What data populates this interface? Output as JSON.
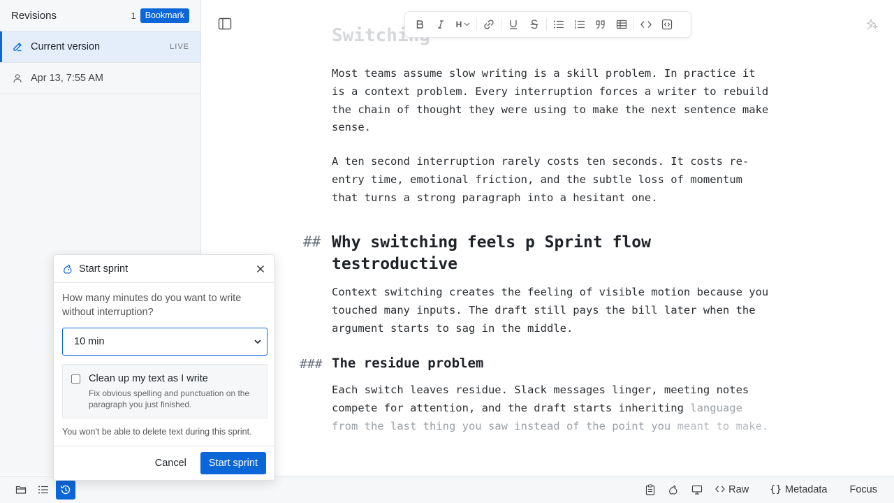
{
  "sidebar": {
    "title": "Revisions",
    "count": "1",
    "bookmark_label": "Bookmark",
    "items": [
      {
        "label": "Current version",
        "tag": "LIVE"
      },
      {
        "label": "Apr 13, 7:55 AM"
      }
    ]
  },
  "toolbar": {
    "heading_label": "H",
    "buttons": [
      "bold-icon",
      "italic-icon",
      "heading-icon",
      "link-icon",
      "underline-icon",
      "strikethrough-icon",
      "bullet-list-icon",
      "numbered-list-icon",
      "quote-icon",
      "table-icon",
      "code-icon",
      "code-block-icon"
    ]
  },
  "editor": {
    "top_heading": "Switching",
    "para1": "Most teams assume slow writing is a skill problem. In practice it is a context problem. Every interruption forces a writer to rebuild the chain of thought they were using to make the next sentence make sense.",
    "para2": "A ten second interruption rarely costs ten seconds. It costs re-entry time, emotional friction, and the subtle loss of momentum that turns a strong paragraph into a hesitant one.",
    "h2_mark": "##",
    "h2_line1": "Why switching feels p Sprint flow",
    "h2_line2": "testroductive",
    "para3": "Context switching creates the feeling of visible motion because you touched many inputs. The draft still pays the bill later when the argument starts to sag in the middle.",
    "h3_mark": "###",
    "h3": "The residue problem",
    "para4a": "Each switch leaves residue. Slack messages linger, meeting notes compete for attention, and the draft starts inheriting",
    "para4b": "language from the last thing you saw instead of the point you",
    "para4c": "meant to make."
  },
  "dialog": {
    "title": "Start sprint",
    "question": "How many minutes do you want to write without interruption?",
    "select_value": "10 min",
    "option_label": "Clean up my text as I write",
    "option_desc": "Fix obvious spelling and punctuation on the paragraph you just finished.",
    "warning": "You won't be able to delete text during this sprint.",
    "cancel_label": "Cancel",
    "start_label": "Start sprint"
  },
  "statusbar": {
    "raw_label": "Raw",
    "metadata_label": "Metadata",
    "focus_label": "Focus"
  },
  "colors": {
    "accent": "#0b66d8",
    "sidebar_bg": "#f6f7f8",
    "active_item_bg": "#e4eefb"
  }
}
